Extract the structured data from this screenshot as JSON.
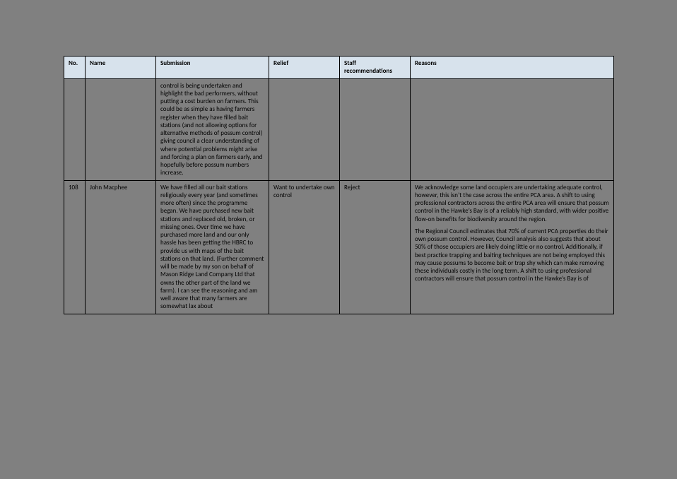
{
  "headers": {
    "no": "No.",
    "name": "Name",
    "submission": "Submission",
    "relief": "Relief",
    "staff": "Staff recommendations",
    "reasons": "Reasons"
  },
  "rows": [
    {
      "no": "",
      "name": "",
      "submission": "control is being undertaken and highlight the bad performers, without putting a cost burden on farmers. This could be as simple as having farmers register when they have filled bait stations (and not allowing options for alternative methods of possum control) giving council a clear understanding of where potential problems might arise and forcing a plan on farmers early, and hopefully before possum numbers increase.",
      "relief": "",
      "staff": "",
      "reasons_p1": "",
      "reasons_p2": ""
    },
    {
      "no": "108",
      "name": "John Macphee",
      "submission": "We have filled all our bait stations religiously every year (and sometimes more often) since the programme began. We have purchased new bait stations and replaced old, broken, or missing ones. Over time we have purchased more land and our only hassle has been getting the HBRC to provide us with maps of the bait stations on that land. (Further comment will be made by my son on behalf of Mason Ridge Land Company Ltd that owns the other part of the land we farm). I can see the reasoning and am well aware that many farmers are somewhat lax about",
      "relief": "Want to undertake own control",
      "staff": "Reject",
      "reasons_p1": "We acknowledge some land occupiers are undertaking adequate control, however, this isn’t the case across the entire PCA area. A shift to using professional contractors across the entire PCA area will ensure that possum control in the Hawke’s Bay is of a reliably high standard, with wider positive flow-on benefits for biodiversity around the region.",
      "reasons_p2": "The Regional Council estimates that 70% of current PCA properties do their own possum control. However, Council analysis also suggests that about 50% of those occupiers are likely doing little or no control. Additionally, if best practice trapping and baiting techniques are not being employed this may cause possums to become bait or trap shy which can make removing these individuals costly in the long term. A shift to using professional contractors will ensure that possum control in the Hawke’s Bay is of"
    }
  ]
}
